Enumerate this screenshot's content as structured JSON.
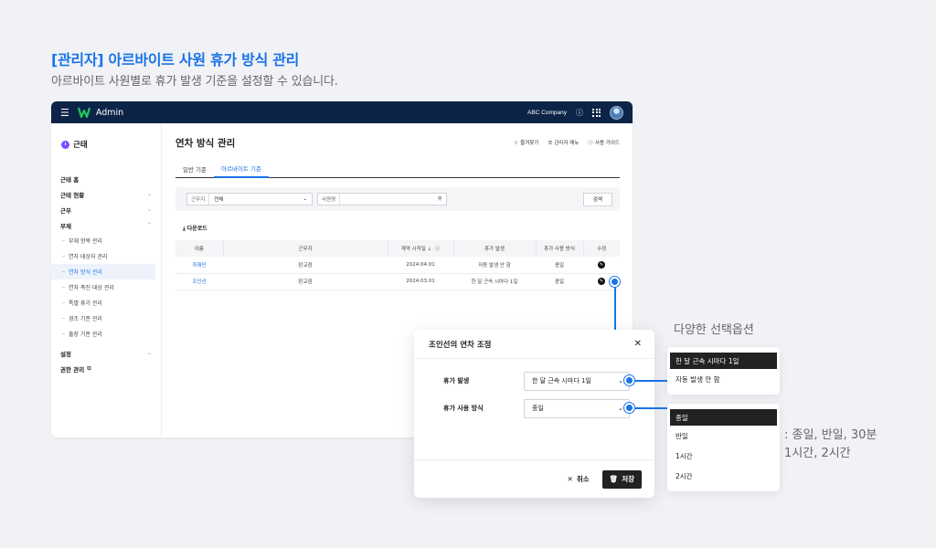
{
  "hero": {
    "title": "[관리자] 아르바이트 사원 휴가 방식 관리",
    "subtitle": "아르바이트 사원별로 휴가 발생 기준을 설정할 수 있습니다."
  },
  "topbar": {
    "app_name": "Admin",
    "company": "ABC Company",
    "help": "?"
  },
  "sidebar": {
    "title": "근태",
    "items": [
      {
        "label": "근태 홈"
      },
      {
        "label": "근태 현황",
        "chev": "⌄"
      },
      {
        "label": "근무",
        "chev": "⌄"
      },
      {
        "label": "부재",
        "chev": "⌃"
      }
    ],
    "subitems": [
      {
        "label": "부재 항목 관리"
      },
      {
        "label": "연차 대상자 관리"
      },
      {
        "label": "연차 방식 관리"
      },
      {
        "label": "연차 촉진 대상 관리"
      },
      {
        "label": "특별 휴가 관리"
      },
      {
        "label": "경조 기준 관리"
      },
      {
        "label": "출장 기준 관리"
      }
    ],
    "bottom": [
      {
        "label": "설정",
        "chev": "⌄"
      },
      {
        "label": "권한 관리"
      }
    ]
  },
  "main": {
    "title": "연차 방식 관리",
    "actions": [
      "즐겨찾기",
      "관리자 메뉴",
      "사용 가이드"
    ],
    "tabs": [
      "일반 기준",
      "아르바이트 기준"
    ],
    "filter": {
      "workplace_label": "근무지",
      "workplace_value": "전체",
      "employee_label": "사원명",
      "search_label": "검색"
    },
    "download": "다운로드",
    "table": {
      "headers": [
        "이름",
        "근무지",
        "계약 시작일",
        "휴가 발생",
        "휴가 사용 방식",
        "수정"
      ],
      "rows": [
        {
          "name": "최재민",
          "workplace": "판교점",
          "start": "2024.04.01",
          "leave": "자동 발생 안 함",
          "usage": "종일"
        },
        {
          "name": "조인선",
          "workplace": "판교점",
          "start": "2024.03.01",
          "leave": "한 달 근속 시마다 1일",
          "usage": "종일"
        }
      ]
    }
  },
  "modal": {
    "title": "조인선의 연차 조정",
    "leave_label": "휴가 발생",
    "leave_value": "한 달 근속 시마다 1일",
    "usage_label": "휴가 사용 방식",
    "usage_value": "종일",
    "cancel": "취소",
    "save": "저장"
  },
  "options": {
    "label": "다양한 선택옵션",
    "leave_options": [
      "한 달 근속 시마다 1일",
      "자동 발생 안 함"
    ],
    "usage_options": [
      "종일",
      "반일",
      "1시간",
      "2시간"
    ],
    "note_line1": ": 종일, 반일, 30분",
    "note_line2": "1시간, 2시간"
  },
  "colors": {
    "accent": "#1a73e8",
    "topbar": "#0b2447",
    "purple": "#7c4dff"
  }
}
